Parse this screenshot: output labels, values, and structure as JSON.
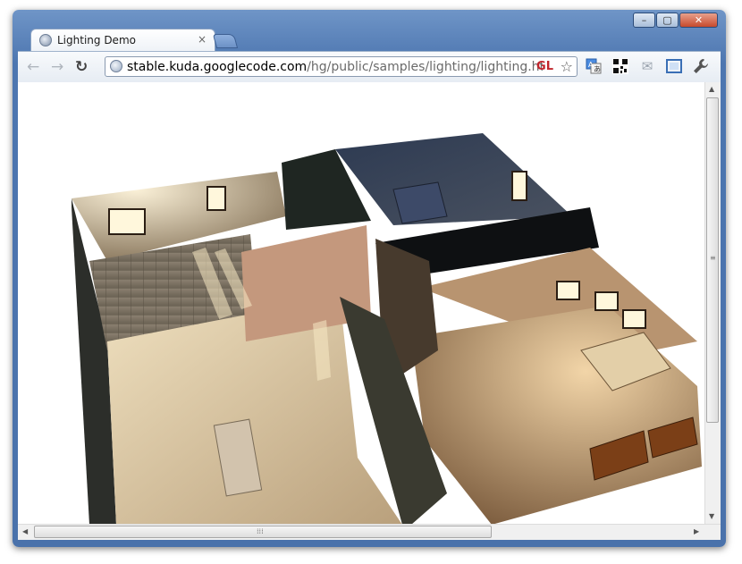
{
  "window": {
    "minimize_label": "–",
    "maximize_label": "▢",
    "close_label": "✕"
  },
  "tab": {
    "title": "Lighting Demo",
    "close_label": "×"
  },
  "toolbar": {
    "back_icon": "←",
    "forward_icon": "→",
    "reload_icon": "↻"
  },
  "omnibox": {
    "url_host": "stable.kuda.googlecode.com",
    "url_path": "/hg/public/samples/lighting/lighting.htm",
    "gl_badge": "GL",
    "star_icon": "☆"
  },
  "extensions": {
    "translate_icon": "A",
    "qr_icon": "▦",
    "mail_icon": "✉",
    "fullscreen_icon": "⛶",
    "wrench_icon": "🔧"
  },
  "scrollbars": {
    "up": "▲",
    "down": "▼",
    "left": "◀",
    "right": "▶",
    "vgrip": "≡",
    "hgrip": "⁞⁞⁞"
  },
  "colors": {
    "titlebar": "#4d76b0",
    "gl_badge": "#c0252c"
  }
}
